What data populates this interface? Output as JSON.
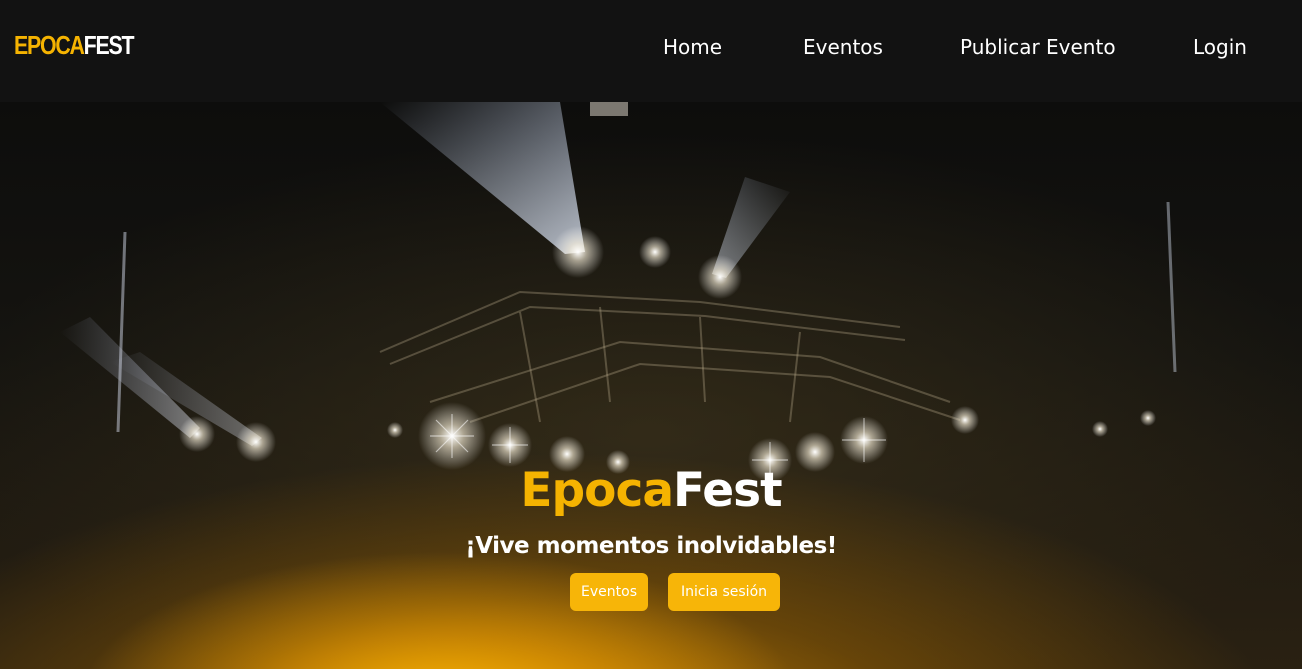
{
  "brand": {
    "logo_part1": "EPOCA",
    "logo_part2": "FEST",
    "accent_color": "#f5b301",
    "background_color": "#121212"
  },
  "nav": {
    "items": [
      {
        "label": "Home"
      },
      {
        "label": "Eventos"
      },
      {
        "label": "Publicar Evento"
      },
      {
        "label": "Login"
      }
    ]
  },
  "hero": {
    "title_part1": "Epoca",
    "title_part2": "Fest",
    "subtitle": "¡Vive momentos inolvidables!",
    "background": "concert stage with spotlights",
    "buttons": [
      {
        "label": "Eventos"
      },
      {
        "label": "Inicia sesión"
      }
    ],
    "button_color": "#f7b508"
  }
}
